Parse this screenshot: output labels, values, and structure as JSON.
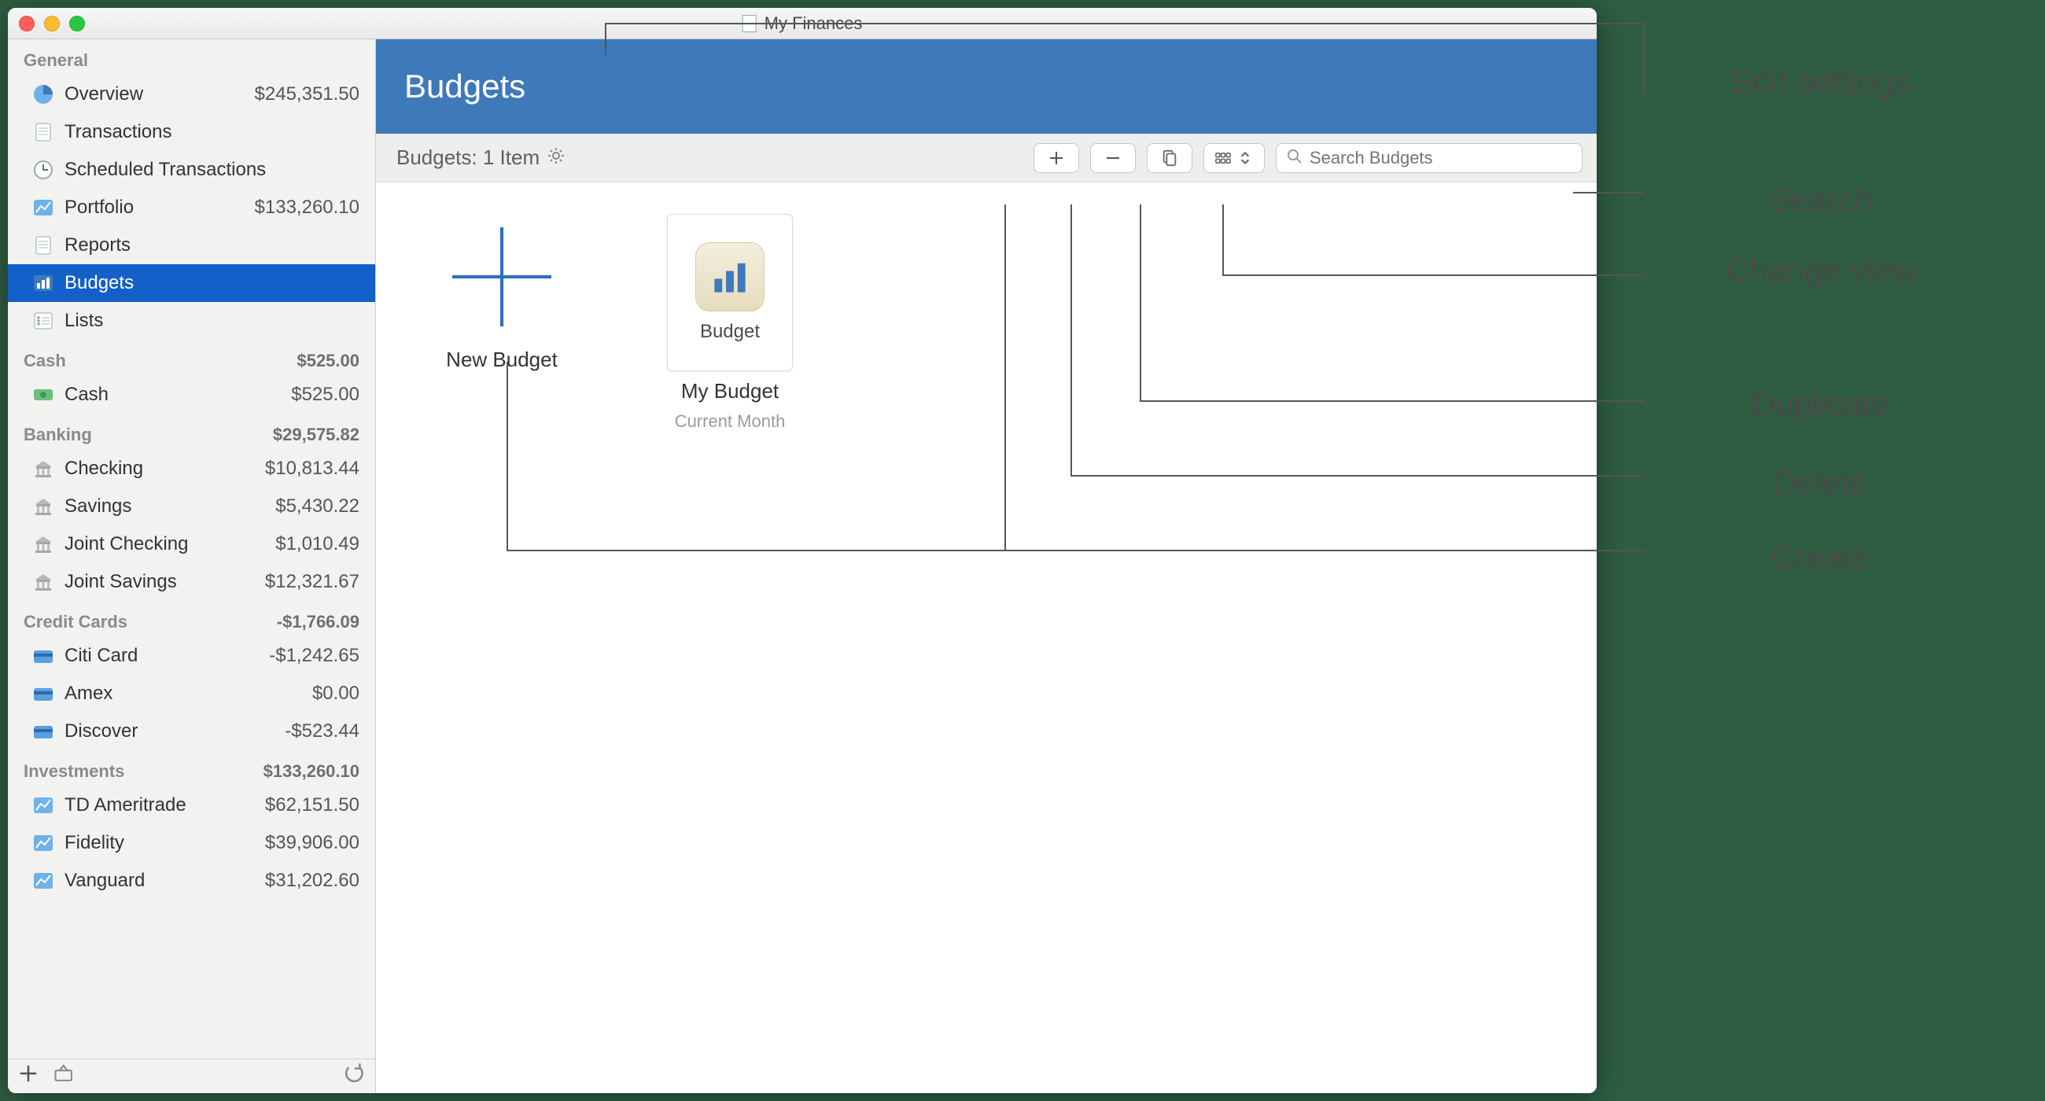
{
  "window": {
    "title": "My Finances"
  },
  "bluebar": {
    "title": "Budgets"
  },
  "toolbar": {
    "count_label": "Budgets: 1 Item",
    "search_placeholder": "Search Budgets"
  },
  "tiles": {
    "new_label": "New Budget",
    "budget_card_label": "Budget",
    "budget_title": "My Budget",
    "budget_sub": "Current Month"
  },
  "sidebar": {
    "groups": [
      {
        "label": "General",
        "amount": "",
        "items": [
          {
            "icon": "pie",
            "label": "Overview",
            "amount": "$245,351.50"
          },
          {
            "icon": "doc",
            "label": "Transactions",
            "amount": ""
          },
          {
            "icon": "clock",
            "label": "Scheduled Transactions",
            "amount": ""
          },
          {
            "icon": "chart",
            "label": "Portfolio",
            "amount": "$133,260.10"
          },
          {
            "icon": "doc",
            "label": "Reports",
            "amount": ""
          },
          {
            "icon": "bars",
            "label": "Budgets",
            "amount": "",
            "selected": true
          },
          {
            "icon": "list",
            "label": "Lists",
            "amount": ""
          }
        ]
      },
      {
        "label": "Cash",
        "amount": "$525.00",
        "items": [
          {
            "icon": "cash",
            "label": "Cash",
            "amount": "$525.00"
          }
        ]
      },
      {
        "label": "Banking",
        "amount": "$29,575.82",
        "items": [
          {
            "icon": "bank",
            "label": "Checking",
            "amount": "$10,813.44"
          },
          {
            "icon": "bank",
            "label": "Savings",
            "amount": "$5,430.22"
          },
          {
            "icon": "bank",
            "label": "Joint Checking",
            "amount": "$1,010.49"
          },
          {
            "icon": "bank",
            "label": "Joint Savings",
            "amount": "$12,321.67"
          }
        ]
      },
      {
        "label": "Credit Cards",
        "amount": "-$1,766.09",
        "items": [
          {
            "icon": "card",
            "label": "Citi Card",
            "amount": "-$1,242.65"
          },
          {
            "icon": "card",
            "label": "Amex",
            "amount": "$0.00"
          },
          {
            "icon": "card",
            "label": "Discover",
            "amount": "-$523.44"
          }
        ]
      },
      {
        "label": "Investments",
        "amount": "$133,260.10",
        "items": [
          {
            "icon": "chart",
            "label": "TD Ameritrade",
            "amount": "$62,151.50"
          },
          {
            "icon": "chart",
            "label": "Fidelity",
            "amount": "$39,906.00"
          },
          {
            "icon": "chart",
            "label": "Vanguard",
            "amount": "$31,202.60"
          }
        ]
      }
    ]
  },
  "callouts": {
    "edit": "Edit settings.",
    "search": "Search.",
    "view": "Change view.",
    "duplicate": "Duplicate.",
    "delete": "Delete.",
    "create": "Create."
  },
  "colors": {
    "accent": "#3e79b9",
    "selection": "#1460c9"
  }
}
